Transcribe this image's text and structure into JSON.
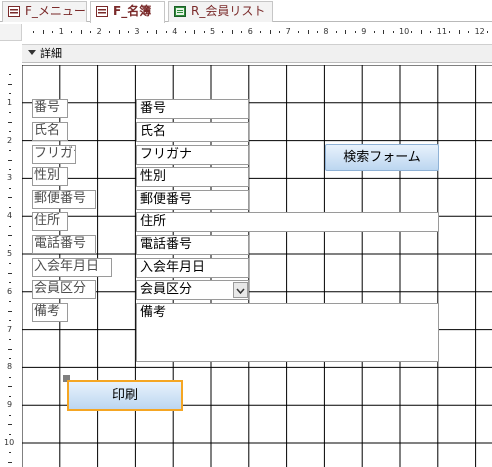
{
  "tabs": [
    {
      "label": "F_メニュー",
      "icon": "form-icon",
      "active": false
    },
    {
      "label": "F_名簿",
      "icon": "form-icon",
      "active": true
    },
    {
      "label": "R_会員リスト",
      "icon": "report-icon",
      "active": false
    }
  ],
  "section": {
    "label": "詳細"
  },
  "ruler": {
    "horizontal": [
      "1",
      "2",
      "3",
      "4",
      "5",
      "6",
      "7",
      "8",
      "9",
      "10",
      "11",
      "12"
    ],
    "vertical": [
      "1",
      "2",
      "3",
      "4",
      "5",
      "6",
      "7",
      "8",
      "9",
      "10"
    ]
  },
  "fields": [
    {
      "label": "番号",
      "value": "番号"
    },
    {
      "label": "氏名",
      "value": "氏名"
    },
    {
      "label": "フリガナ",
      "value": "フリガナ"
    },
    {
      "label": "性別",
      "value": "性別"
    },
    {
      "label": "郵便番号",
      "value": "郵便番号"
    },
    {
      "label": "住所",
      "value": "住所"
    },
    {
      "label": "電話番号",
      "value": "電話番号"
    },
    {
      "label": "入会年月日",
      "value": "入会年月日"
    },
    {
      "label": "会員区分",
      "value": "会員区分"
    },
    {
      "label": "備考",
      "value": "備考"
    }
  ],
  "buttons": {
    "search_form": "検索フォーム",
    "print": "印刷"
  },
  "colors": {
    "selection": "#f5a623",
    "button_top": "#e8f2fc",
    "button_bottom": "#bcd6f0",
    "tab_text": "#7a2a2a"
  }
}
